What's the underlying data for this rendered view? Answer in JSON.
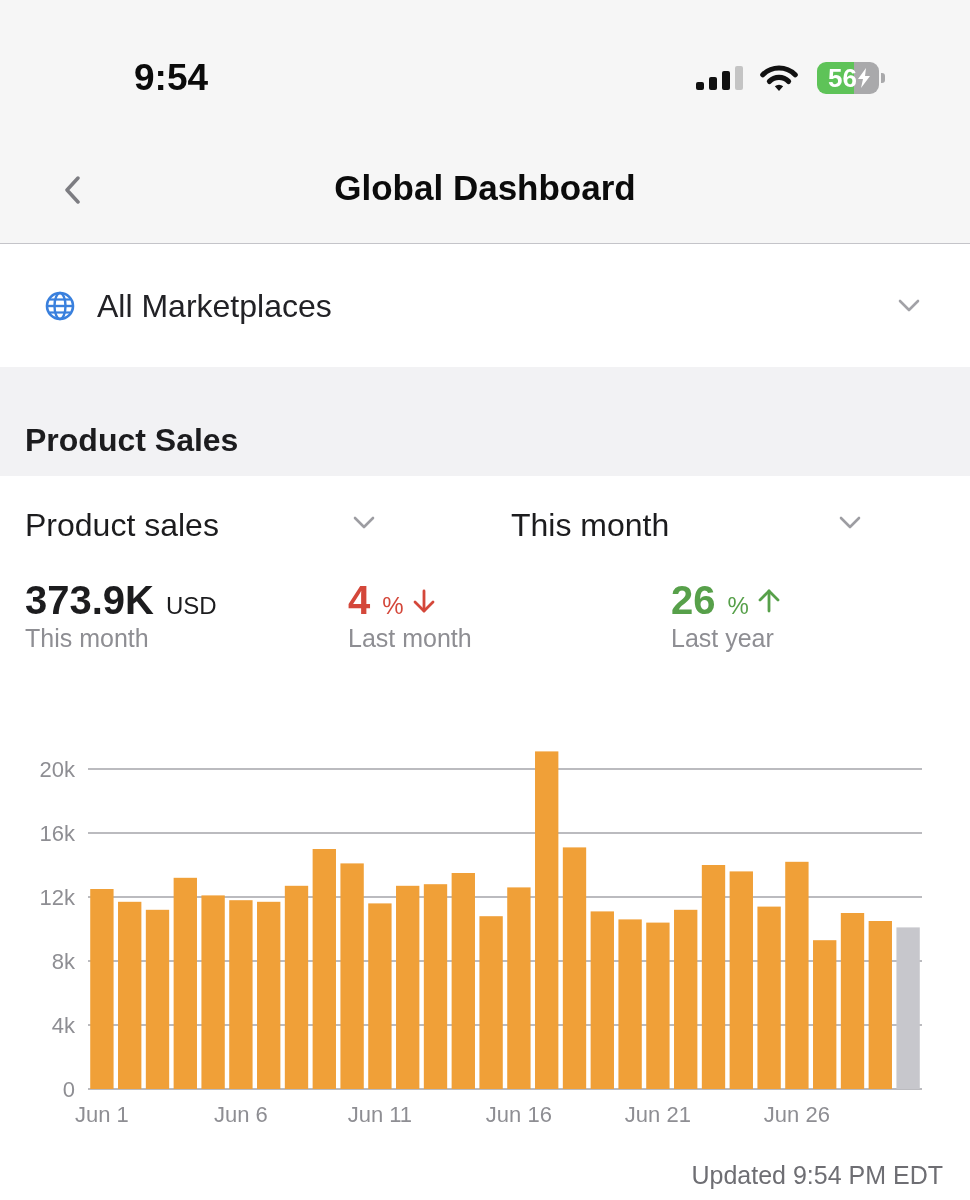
{
  "status_bar": {
    "time": "9:54",
    "battery": {
      "text": "56",
      "charging": true
    }
  },
  "nav_bar": {
    "title": "Global Dashboard"
  },
  "marketplace_selector": {
    "label": "All Marketplaces"
  },
  "product_sales": {
    "title": "Product Sales",
    "filters": [
      {
        "label": "Product sales"
      },
      {
        "label": "This month"
      }
    ],
    "metrics": [
      {
        "kind": "total",
        "value": "373.9K",
        "unit": "USD",
        "label": "This month"
      },
      {
        "kind": "change",
        "value": "4",
        "unit": "%",
        "rising": false,
        "label": "Last month"
      },
      {
        "kind": "change",
        "value": "26",
        "unit": "%",
        "rising": true,
        "label": "Last year"
      }
    ],
    "chart_data": {
      "type": "bar",
      "categories": [
        "Jun 1",
        null,
        null,
        null,
        null,
        "Jun 6",
        null,
        null,
        null,
        null,
        "Jun 11",
        null,
        null,
        null,
        null,
        "Jun 16",
        null,
        null,
        null,
        null,
        "Jun 21",
        null,
        null,
        null,
        null,
        "Jun 26",
        null,
        null,
        null,
        null
      ],
      "series": [
        {
          "color": "#f0a038",
          "values": [
            12500,
            11700,
            11200,
            13200,
            12100,
            11800,
            11700,
            12700,
            15000,
            14100,
            11600,
            12700,
            12800,
            13500,
            10800,
            12600,
            21100,
            15100,
            11100,
            10600,
            10400,
            11200,
            14000,
            13600,
            11400,
            14200,
            9300,
            11000,
            10500,
            null
          ]
        },
        {
          "color": "#c7c7cc",
          "values": [
            null,
            null,
            null,
            null,
            null,
            null,
            null,
            null,
            null,
            null,
            null,
            null,
            null,
            null,
            null,
            null,
            null,
            null,
            null,
            null,
            null,
            null,
            null,
            null,
            null,
            null,
            null,
            null,
            null,
            10100
          ]
        }
      ],
      "grid": true,
      "ylim": [
        0,
        21100
      ],
      "yticks": [
        {
          "value": 0,
          "label": "0"
        },
        {
          "value": 4000,
          "label": "4k"
        },
        {
          "value": 8000,
          "label": "8k"
        },
        {
          "value": 12000,
          "label": "12k"
        },
        {
          "value": 16000,
          "label": "16k"
        },
        {
          "value": 20000,
          "label": "20k"
        }
      ]
    },
    "updated": "Updated 9:54 PM EDT"
  }
}
